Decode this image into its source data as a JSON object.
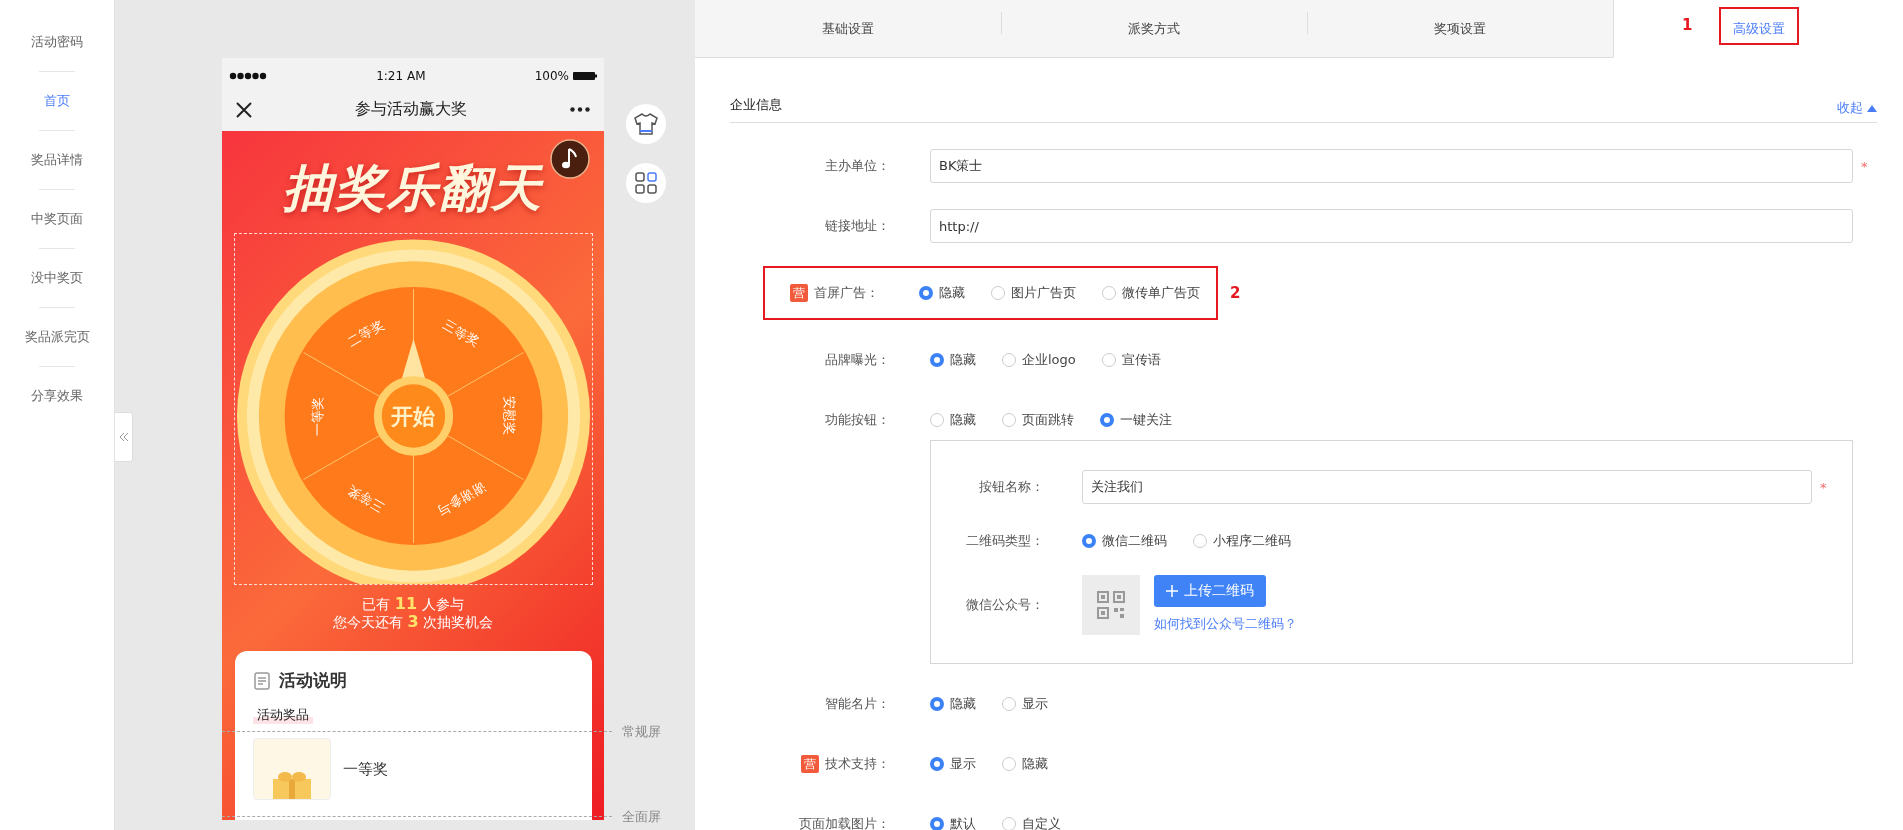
{
  "sidebar": {
    "items": [
      {
        "label": "活动密码",
        "selected": false
      },
      {
        "label": "首页",
        "selected": true
      },
      {
        "label": "奖品详情",
        "selected": false
      },
      {
        "label": "中奖页面",
        "selected": false
      },
      {
        "label": "没中奖页",
        "selected": false
      },
      {
        "label": "奖品派完页",
        "selected": false
      },
      {
        "label": "分享效果",
        "selected": false
      }
    ]
  },
  "phone": {
    "status_bar": {
      "time": "1:21 AM",
      "battery": "100%"
    },
    "nav_title": "参与活动赢大奖",
    "banner_title": "抽奖乐翻天",
    "wheel": {
      "segments": [
        "二等奖",
        "三等奖",
        "安慰奖",
        "谢谢参与",
        "三等奖",
        "一等奖"
      ],
      "start": "开始"
    },
    "participants": "已有 **11** 人参与",
    "chances": "您今天还有 **3** 次抽奖机会",
    "card": {
      "title": "活动说明",
      "tag": "活动奖品",
      "prize": "一等奖"
    }
  },
  "screen_markers": [
    "常规屏",
    "全面屏"
  ],
  "tabs": [
    {
      "label": "基础设置",
      "selected": false
    },
    {
      "label": "派奖方式",
      "selected": false
    },
    {
      "label": "奖项设置",
      "selected": false
    },
    {
      "label": "高级设置",
      "selected": true,
      "annotation": "1"
    }
  ],
  "section": {
    "title": "企业信息",
    "toggle": "收起"
  },
  "rows": [
    {
      "kind": "input",
      "label": "主办单位：",
      "value": "BK策士",
      "required_mark": "*"
    },
    {
      "kind": "input",
      "label": "链接地址：",
      "value": "http://"
    },
    {
      "kind": "radio",
      "badge": "营",
      "label": "首屏广告：",
      "annotation": "2",
      "options": [
        {
          "label": "隐藏",
          "selected": true
        },
        {
          "label": "图片广告页",
          "selected": false
        },
        {
          "label": "微传单广告页",
          "selected": false
        }
      ]
    },
    {
      "kind": "radio",
      "label": "品牌曝光：",
      "options": [
        {
          "label": "隐藏",
          "selected": true
        },
        {
          "label": "企业logo",
          "selected": false
        },
        {
          "label": "宣传语",
          "selected": false
        }
      ]
    },
    {
      "kind": "radio",
      "label": "功能按钮：",
      "options": [
        {
          "label": "隐藏",
          "selected": false
        },
        {
          "label": "页面跳转",
          "selected": false
        },
        {
          "label": "一键关注",
          "selected": true
        }
      ],
      "panel": [
        {
          "kind": "input",
          "label": "按钮名称：",
          "value": "关注我们",
          "required_mark": "*"
        },
        {
          "kind": "radio",
          "label": "二维码类型：",
          "options": [
            {
              "label": "微信二维码",
              "selected": true
            },
            {
              "label": "小程序二维码",
              "selected": false
            }
          ]
        },
        {
          "kind": "upload",
          "label": "微信公众号：",
          "button": "上传二维码",
          "link": "如何找到公众号二维码？"
        }
      ]
    },
    {
      "kind": "radio",
      "label": "智能名片：",
      "options": [
        {
          "label": "隐藏",
          "selected": true
        },
        {
          "label": "显示",
          "selected": false
        }
      ]
    },
    {
      "kind": "radio",
      "badge": "营",
      "label": "技术支持：",
      "options": [
        {
          "label": "显示",
          "selected": true
        },
        {
          "label": "隐藏",
          "selected": false
        }
      ]
    },
    {
      "kind": "radio",
      "label": "页面加载图片：",
      "options": [
        {
          "label": "默认",
          "selected": true
        },
        {
          "label": "自定义",
          "selected": false
        }
      ]
    }
  ]
}
